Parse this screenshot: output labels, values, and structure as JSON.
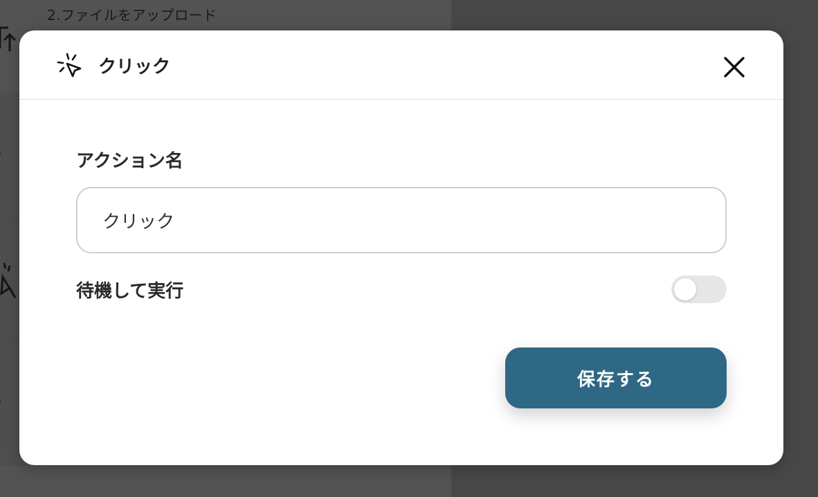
{
  "background": {
    "step_title": "2.ファイルをアップロード"
  },
  "modal": {
    "title": "クリック",
    "icon": "click-cursor-icon",
    "close_icon": "close-icon",
    "action_name_label": "アクション名",
    "action_name_value": "クリック",
    "wait_label": "待機して実行",
    "wait_enabled": false,
    "save_label": "保存する"
  },
  "colors": {
    "primary": "#2f6884",
    "toggle_off": "#e6e6e6"
  }
}
